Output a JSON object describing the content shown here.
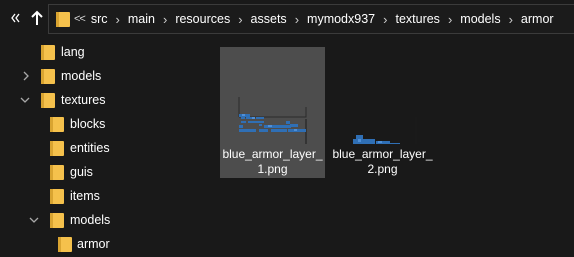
{
  "window": {
    "background": "#191919"
  },
  "nav": {
    "chevron_icon": "chevron-left-double-icon",
    "up_icon": "up-arrow-icon"
  },
  "address": {
    "overflow": "<<",
    "crumbs": [
      "src",
      "main",
      "resources",
      "assets",
      "mymodx937",
      "textures",
      "models",
      "armor"
    ]
  },
  "tree": [
    {
      "label": "lang",
      "expand": "none",
      "depth": 0
    },
    {
      "label": "models",
      "expand": "collapsed",
      "depth": 0
    },
    {
      "label": "textures",
      "expand": "expanded",
      "depth": 0
    },
    {
      "label": "blocks",
      "expand": "none",
      "depth": 1
    },
    {
      "label": "entities",
      "expand": "none",
      "depth": 1
    },
    {
      "label": "guis",
      "expand": "none",
      "depth": 1
    },
    {
      "label": "items",
      "expand": "none",
      "depth": 1
    },
    {
      "label": "models",
      "expand": "expanded",
      "depth": 1
    },
    {
      "label": "armor",
      "expand": "none",
      "depth": 2
    }
  ],
  "files": [
    {
      "name": "blue_armor_layer_1.png",
      "selected": true
    },
    {
      "name": "blue_armor_layer_2.png",
      "selected": false
    }
  ],
  "colors": {
    "folder": "#f5c14c",
    "folder_dark": "#d9a431",
    "selected_tile": "#4d4d4d",
    "armor_blue": "#2f6fb5"
  }
}
